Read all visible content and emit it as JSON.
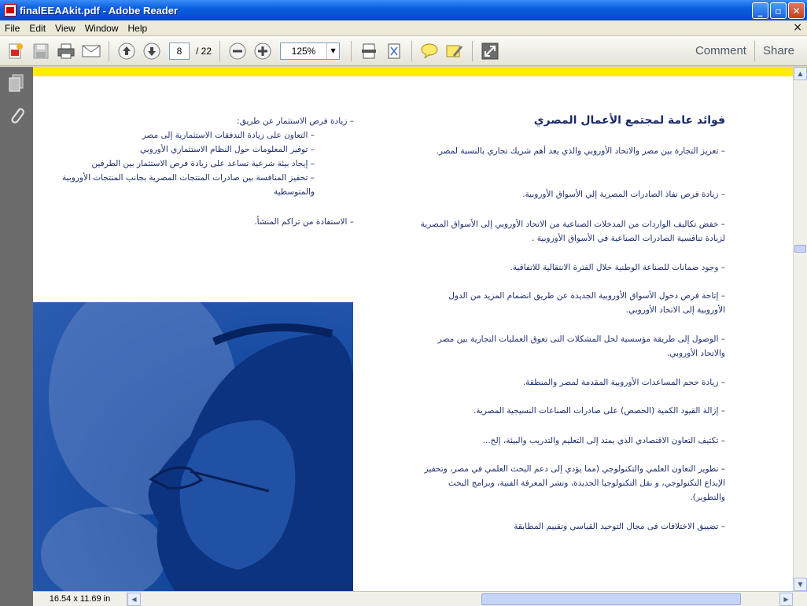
{
  "window": {
    "title": "finalEEAAkit.pdf - Adobe Reader",
    "minimize": "_",
    "maximize": "▫",
    "close": "✕"
  },
  "menu": {
    "items": [
      "File",
      "Edit",
      "View",
      "Window",
      "Help"
    ],
    "close": "×"
  },
  "toolbar": {
    "page_current": "8",
    "page_total": "/ 22",
    "zoom": "125%",
    "comment": "Comment",
    "share": "Share"
  },
  "document": {
    "heading": "فوائد عامة لمجتمع الأعمال المصري",
    "right_bullets": [
      "تعزيز التجارة بين مصر والاتحاد الأوروبي والذي يعد أهم شريك تجاري بالنسبة لمصر.",
      "زيادة فرص نفاذ الصادرات المصرية  إلي الأسواق الأوروبية.",
      "خفض تكاليف الواردات من المدخلات الصناعية من الاتحاد الأوروبي إلى الأسواق المصرية لزيادة تنافسية الصادرات الصناعية في الأسواق الأوروبية  .",
      "وجود ضمانات للصناعة الوطنية خلال الفترة الانتقالية للاتفاقية.",
      "إتاحة فرص دخول الأسواق الأوروبية الجديدة عن طريق انضمام المزيد من الدول الأوروبية إلى الاتحاد الأوروبي.",
      "الوصول إلى طريقة مؤسسية لحل المشكلات التى تعوق العمليات التجارية بين مصر والاتحاد الأوروبي.",
      "زيادة حجم المساعدات الأوروبية المقدمة لمصر والمنطقة.",
      "إزالة القيود الكمية (الحصص) على صادرات الصناعات النسيجية المصرية.",
      "تكثيف التعاون الاقتصادي الذي يمتد إلى التعليم والتدريب والبيئة، إلخ...",
      "تطوير التعاون العلمي والتكنولوجي (مما يؤدي إلى دعم البحث العلمي في مصر، وتحفيز الإبداع التكنولوجي، و نقل التكنولوجيا الجديدة، ونشر المعرفة الفنية، وبرامج البحث والتطوير).",
      "تضييق الاختلافات فى مجال التوحيد القياسي وتقييم المطابقة"
    ],
    "left_main": "زيادة فرص الاستثمار عن طريق:",
    "left_sub": [
      "التعاون على زيادة  التدفقات الاستثمارية إلى مصر",
      "توفير المعلومات حول النظام الاستثماري الأوروبي",
      "إيجاد بيئة شرعية تساعد على زيادة فرص الاستثمار بين الطرفين",
      "تحفيز المنافسة بين صادرات المنتجات المصرية بجانب المنتجات الأوروبية والمتوسطية"
    ],
    "left_last": "الاستفادة من تراكم المنشأ."
  },
  "status": {
    "page_size": "16.54 x 11.69 in"
  },
  "colors": {
    "accent_yellow": "#ffec00",
    "text_navy": "#1e2f6e",
    "photo_blue": "#1c4fa6"
  }
}
